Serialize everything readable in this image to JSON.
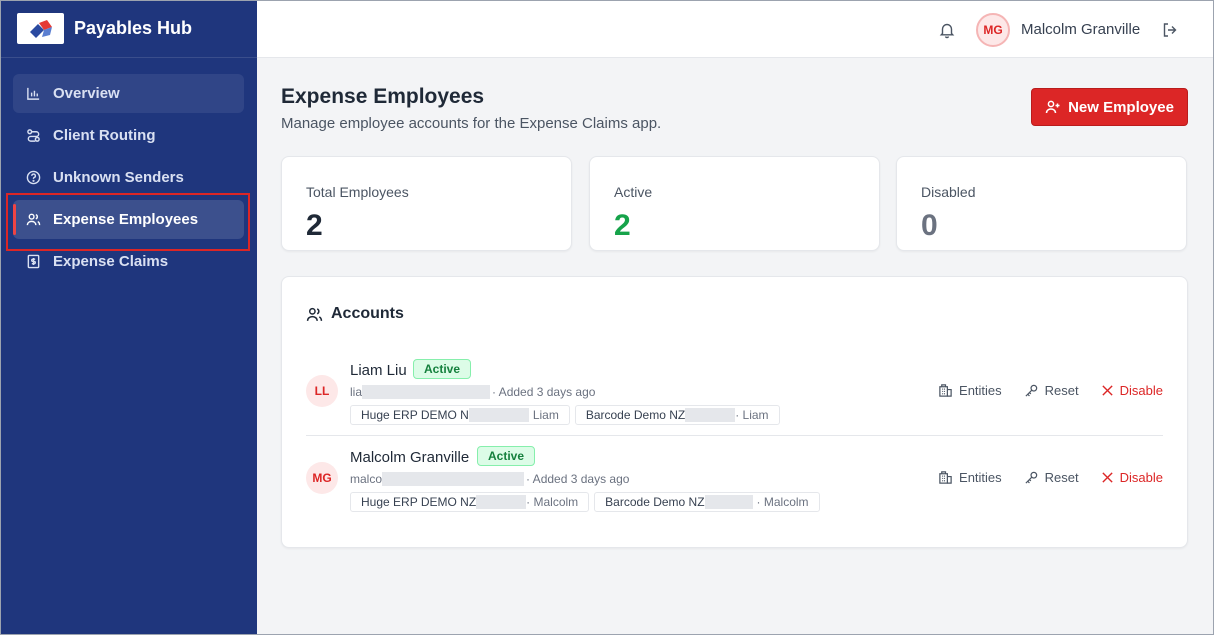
{
  "app": {
    "title": "Payables Hub",
    "logo_icon": "payables-hub-logo"
  },
  "sidebar": {
    "items": [
      {
        "label": "Overview",
        "icon": "bar-chart-icon"
      },
      {
        "label": "Client Routing",
        "icon": "route-icon"
      },
      {
        "label": "Unknown Senders",
        "icon": "question-circle-icon"
      },
      {
        "label": "Expense Employees",
        "icon": "users-icon"
      },
      {
        "label": "Expense Claims",
        "icon": "receipt-dollar-icon"
      }
    ],
    "active_index": 3
  },
  "header": {
    "user_initials": "MG",
    "user_name": "Malcolm Granville",
    "icons": [
      "bell-icon",
      "logout-icon"
    ]
  },
  "page": {
    "title": "Expense Employees",
    "subtitle": "Manage employee accounts for the Expense Claims app.",
    "new_button": "New Employee"
  },
  "stats": [
    {
      "label": "Total Employees",
      "value": "2",
      "color": "#1f2937"
    },
    {
      "label": "Active",
      "value": "2",
      "color": "#16a34a"
    },
    {
      "label": "Disabled",
      "value": "0",
      "color": "#6b7280"
    }
  ],
  "accounts": {
    "title": "Accounts",
    "actions": {
      "entities": "Entities",
      "reset": "Reset",
      "disable": "Disable"
    },
    "rows": [
      {
        "initials": "LL",
        "name": "Liam Liu",
        "status": "Active",
        "email_prefix": "lia",
        "added": "· Added 3 days ago",
        "chips": [
          {
            "entity": "Huge ERP DEMO N",
            "user": "Liam"
          },
          {
            "entity": "Barcode Demo NZ",
            "user": "· Liam"
          }
        ]
      },
      {
        "initials": "MG",
        "name": "Malcolm Granville",
        "status": "Active",
        "email_prefix": "malco",
        "added": "· Added 3 days ago",
        "chips": [
          {
            "entity": "Huge ERP DEMO NZ",
            "user": "· Malcolm"
          },
          {
            "entity": "Barcode Demo NZ",
            "user": "· Malcolm"
          }
        ]
      }
    ]
  }
}
